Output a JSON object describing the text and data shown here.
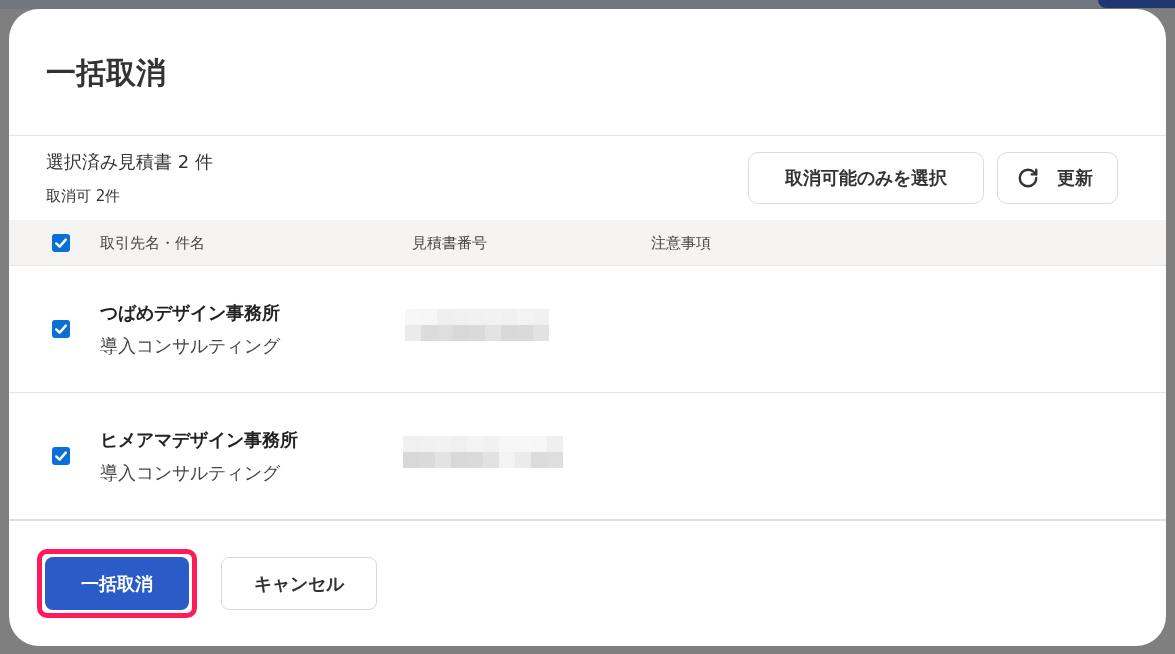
{
  "dialog": {
    "title": "一括取消"
  },
  "summary": {
    "selected_count": "選択済み見積書 2 件",
    "cancellable_count": "取消可 2件"
  },
  "toolbar_buttons": [
    {
      "kind": "text",
      "label": "取消可能のみを選択"
    },
    {
      "kind": "refresh",
      "label": "更新"
    }
  ],
  "table": {
    "select_all": {
      "checked": true
    },
    "columns": [
      "取引先名・件名",
      "見積書番号",
      "注意事項"
    ],
    "rows": [
      {
        "checked": true,
        "client": "つばめデザイン事務所",
        "subject": "導入コンサルティング",
        "quote_number_redacted": true
      },
      {
        "checked": true,
        "client": "ヒメアマデザイン事務所",
        "subject": "導入コンサルティング",
        "quote_number_redacted": true
      }
    ]
  },
  "footer_buttons": [
    {
      "kind": "primary",
      "label": "一括取消",
      "highlighted": true
    },
    {
      "kind": "secondary",
      "label": "キャンセル",
      "highlighted": false
    }
  ]
}
